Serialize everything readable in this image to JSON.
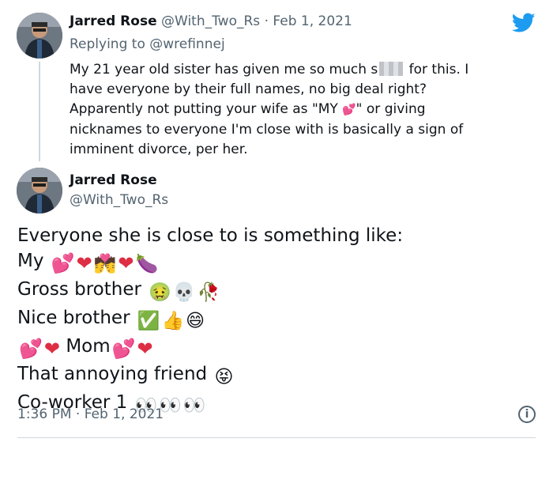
{
  "tweet1": {
    "author_name": "Jarred Rose",
    "handle": "@With_Two_Rs",
    "separator": "·",
    "date": "Feb 1, 2021",
    "replying_prefix": "Replying to ",
    "replying_handle": "@wrefinnej",
    "body_line1_a": "My 21 year old sister has given me so much s",
    "body_line1_b": " for this. I",
    "body_line2": "have everyone by their full names, no big deal right?",
    "body_line3_a": "Apparently not putting your wife as \"MY ",
    "body_line3_b": "\" or giving",
    "body_line4": "nicknames to everyone I'm close with is basically a sign of",
    "body_line5": "imminent divorce, per her."
  },
  "tweet2": {
    "author_name": "Jarred Rose",
    "handle": "@With_Two_Rs",
    "lines": {
      "intro": "Everyone she is close to is something like:",
      "my": "My",
      "gross_brother": "Gross brother",
      "nice_brother": "Nice brother",
      "mom": "Mom",
      "annoying_friend": "That annoying friend",
      "coworker": "Co-worker 1"
    },
    "timestamp": "1:36 PM · Feb 1, 2021"
  },
  "icons": {
    "info": "i",
    "twitter_brand": "twitter-bird-icon"
  },
  "colors": {
    "twitter_blue": "#1d9bf0",
    "heart_red": "#dd2e44",
    "text_grey": "#536471"
  }
}
